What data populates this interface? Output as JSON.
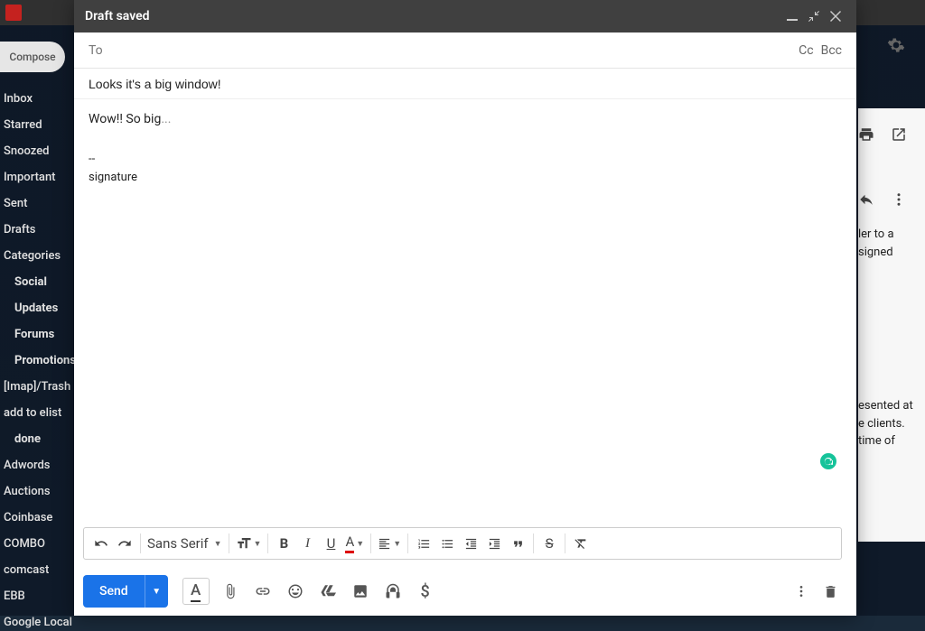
{
  "header": {
    "title": "Draft saved"
  },
  "compose_btn": "Compose",
  "nav": [
    {
      "label": "Inbox",
      "indent": false
    },
    {
      "label": "Starred",
      "indent": false
    },
    {
      "label": "Snoozed",
      "indent": false
    },
    {
      "label": "Important",
      "indent": false
    },
    {
      "label": "Sent",
      "indent": false
    },
    {
      "label": "Drafts",
      "indent": false
    },
    {
      "label": "Categories",
      "indent": false
    },
    {
      "label": "Social",
      "indent": true
    },
    {
      "label": "Updates",
      "indent": true
    },
    {
      "label": "Forums",
      "indent": true
    },
    {
      "label": "Promotions",
      "indent": true
    },
    {
      "label": "[Imap]/Trash",
      "indent": false
    },
    {
      "label": "add to elist",
      "indent": false
    },
    {
      "label": "done",
      "indent": true
    },
    {
      "label": "Adwords",
      "indent": false
    },
    {
      "label": "Auctions",
      "indent": false
    },
    {
      "label": "Coinbase",
      "indent": false
    },
    {
      "label": "COMBO",
      "indent": false
    },
    {
      "label": "comcast",
      "indent": false
    },
    {
      "label": "EBB",
      "indent": false
    },
    {
      "label": "Google Local",
      "indent": false
    }
  ],
  "to": {
    "label": "To",
    "value": "",
    "cc": "Cc",
    "bcc": "Bcc"
  },
  "subject": {
    "value": "Looks it's a big window!"
  },
  "body": {
    "lead": "Wow!!  So big",
    "trail": "...",
    "sig_divider": "--",
    "signature": "signature"
  },
  "format": {
    "font_name": "Sans Serif",
    "undo": "↶",
    "redo": "↷",
    "size": "Size",
    "bold": "B",
    "italic": "I",
    "underline": "U",
    "color": "A",
    "align": "Align",
    "numlist": "NumList",
    "bullist": "BulList",
    "outdent": "Outdent",
    "indent": "Indent",
    "quote": "Quote",
    "strike": "S",
    "clear": "Tx"
  },
  "send": {
    "label": "Send"
  },
  "bottom_icons": [
    "text-format",
    "attach",
    "link",
    "emoji",
    "drive",
    "photo",
    "confidential",
    "money"
  ],
  "bg_text1": "ler to a signed",
  "bg_text2": "esented at e clients. time of"
}
